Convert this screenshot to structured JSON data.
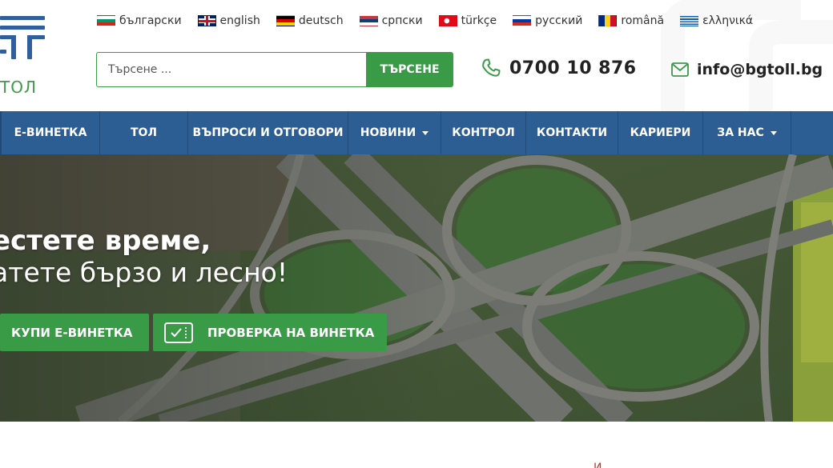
{
  "logo": {
    "text": "ТОЛ"
  },
  "languages": [
    {
      "label": "български",
      "flag": "bg-flag-icon",
      "colors": [
        "#ffffff",
        "#00966e",
        "#d62612"
      ]
    },
    {
      "label": "english",
      "flag": "uk-flag-icon",
      "colors": [
        "#012169",
        "#ffffff",
        "#c8102e"
      ]
    },
    {
      "label": "deutsch",
      "flag": "de-flag-icon",
      "colors": [
        "#000000",
        "#dd0000",
        "#ffce00"
      ]
    },
    {
      "label": "српски",
      "flag": "rs-flag-icon",
      "colors": [
        "#c6363c",
        "#0c4076",
        "#ffffff"
      ]
    },
    {
      "label": "türkçe",
      "flag": "tr-flag-icon",
      "colors": [
        "#e30a17",
        "#e30a17",
        "#e30a17"
      ]
    },
    {
      "label": "русский",
      "flag": "ru-flag-icon",
      "colors": [
        "#ffffff",
        "#0039a6",
        "#d52b1e"
      ]
    },
    {
      "label": "română",
      "flag": "ro-flag-icon",
      "colors": [
        "#002b7f",
        "#fcd116",
        "#ce1126"
      ]
    },
    {
      "label": "ελληνικά",
      "flag": "gr-flag-icon",
      "colors": [
        "#0d5eaf",
        "#ffffff",
        "#0d5eaf"
      ]
    }
  ],
  "search": {
    "placeholder": "Търсене ...",
    "button": "ТЪРСЕНЕ"
  },
  "contact": {
    "phone": "0700 10 876",
    "email": "info@bgtoll.bg"
  },
  "nav": [
    {
      "label": "Е-ВИНЕТКА",
      "dropdown": false
    },
    {
      "label": "ТОЛ",
      "dropdown": false
    },
    {
      "label": "ВЪПРОСИ И ОТГОВОРИ",
      "dropdown": false
    },
    {
      "label": "НОВИНИ",
      "dropdown": true
    },
    {
      "label": "КОНТРОЛ",
      "dropdown": false
    },
    {
      "label": "КОНТАКТИ",
      "dropdown": false
    },
    {
      "label": "КАРИЕРИ",
      "dropdown": false
    },
    {
      "label": "ЗА НАС",
      "dropdown": true
    }
  ],
  "hero": {
    "headline": "естете време,",
    "subheadline": "атете бързо и лесно!",
    "buy_button": "КУПИ Е-ВИНЕТКА",
    "check_button": "ПРОВЕРКА НА ВИНЕТКА"
  },
  "footer": {
    "mark": "И"
  },
  "colors": {
    "brand_green": "#3a9b47",
    "nav_blue": "#2c5d93",
    "logo_blue": "#2f5f9c"
  }
}
